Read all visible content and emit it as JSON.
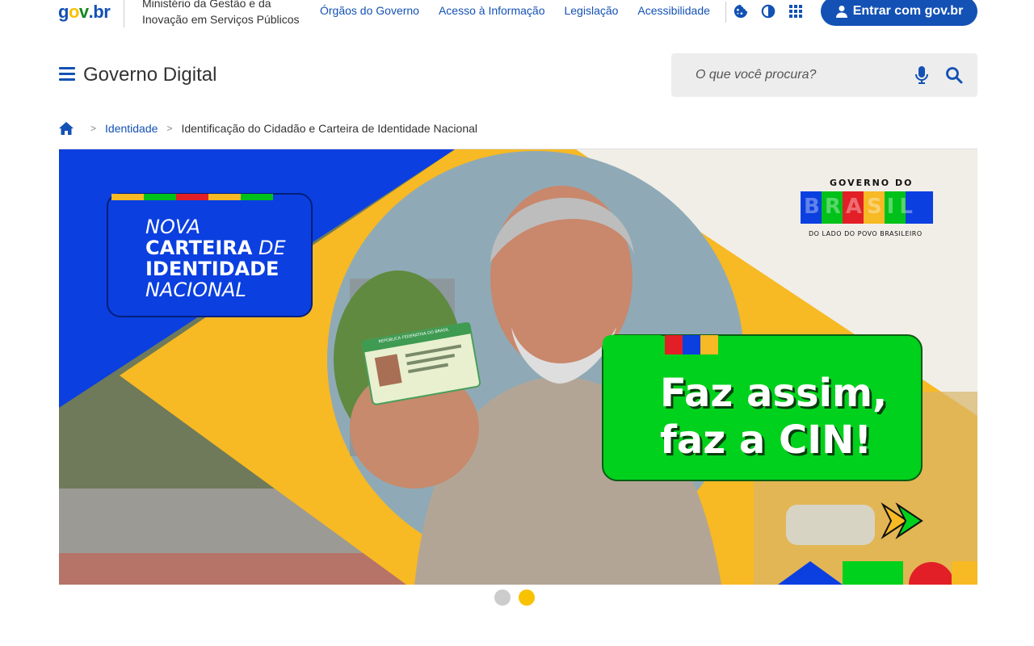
{
  "header": {
    "logo_parts": [
      "g",
      "o",
      "v",
      ".",
      "br"
    ],
    "ministry_line1": "Ministério da Gestão e da",
    "ministry_line2": "Inovação em Serviços Públicos",
    "nav": [
      "Órgãos do Governo",
      "Acesso à Informação",
      "Legislação",
      "Acessibilidade"
    ],
    "tools": [
      "cookie-icon",
      "contrast-icon",
      "apps-grid-icon"
    ],
    "login_label": "Entrar com gov.br"
  },
  "site": {
    "title": "Governo Digital",
    "search_placeholder": "O que você procura?"
  },
  "breadcrumb": {
    "items": [
      "Identidade",
      "Identificação do Cidadão e Carteira de Identidade Nacional"
    ]
  },
  "banner": {
    "nova": "NOVA",
    "carteira": "CARTEIRA",
    "de": "DE",
    "identidade": "IDENTIDADE",
    "nacional": "NACIONAL",
    "gov_do": "GOVERNO DO",
    "brasil": "BRASIL",
    "slogan": "DO LADO DO POVO BRASILEIRO",
    "cta_line1": "Faz assim,",
    "cta_line2": "faz a CIN!",
    "card_header": "REPÚBLICA FEDERATIVA DO BRASIL"
  },
  "carousel": {
    "slides": 2,
    "active_index": 1
  },
  "colors": {
    "primary": "#1351b4",
    "banner_blue": "#0b3fe0",
    "banner_yellow": "#f7b924",
    "cta_green": "#00d11c",
    "dot_inactive": "#cccccc",
    "dot_active": "#f8c200"
  }
}
